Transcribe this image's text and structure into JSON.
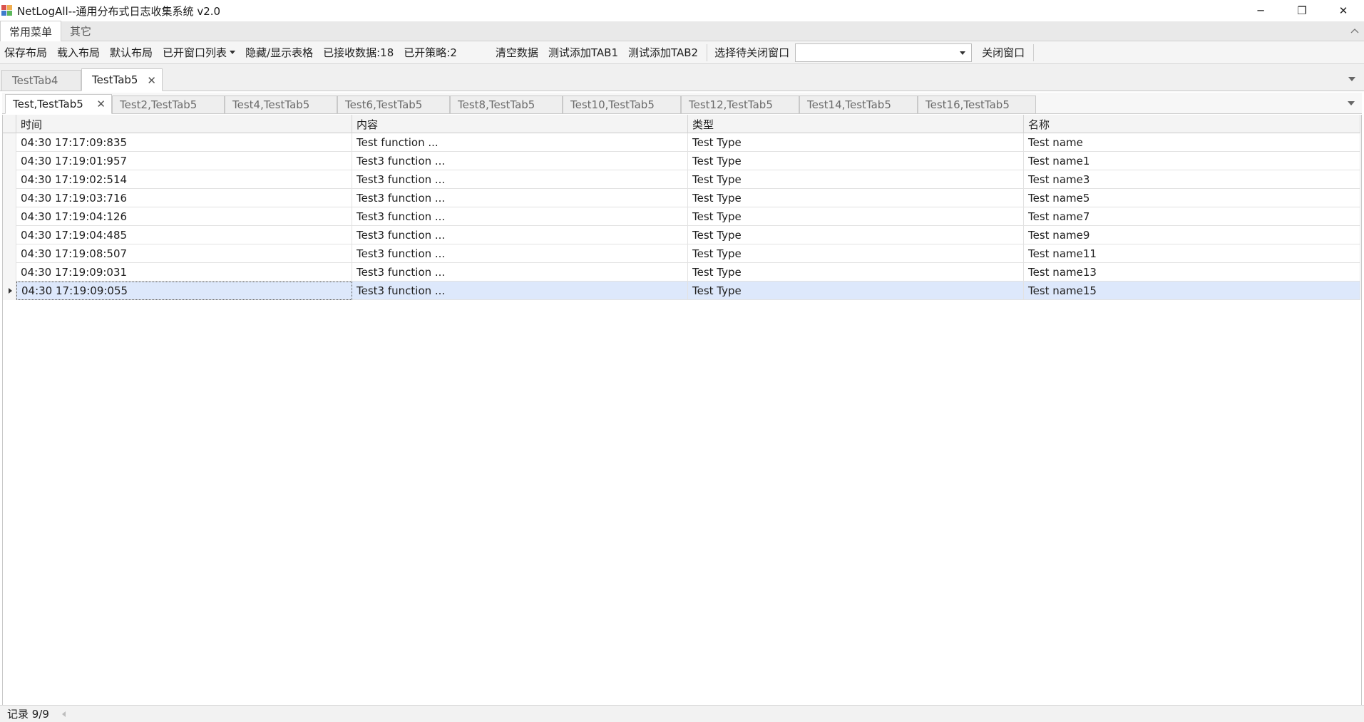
{
  "window": {
    "title": "NetLogAll--通用分布式日志收集系统 v2.0",
    "controls": {
      "minimize": "─",
      "restore": "❐",
      "close": "✕"
    }
  },
  "ribbon": {
    "tabs": [
      {
        "label": "常用菜单",
        "active": true
      },
      {
        "label": "其它",
        "active": false
      }
    ],
    "collapse_icon": "chevron-up-icon"
  },
  "toolbar": {
    "save_layout": "保存布局",
    "load_layout": "载入布局",
    "default_layout": "默认布局",
    "open_windows": "已开窗口列表",
    "toggle_grid": "隐藏/显示表格",
    "received": "已接收数据:18",
    "strategies": "已开策略:2",
    "clear_data": "清空数据",
    "test_add_tab1": "测试添加TAB1",
    "test_add_tab2": "测试添加TAB2",
    "select_close_label": "选择待关闭窗口",
    "select_close_value": "",
    "close_window": "关闭窗口"
  },
  "doc_tabs": [
    {
      "label": "TestTab4",
      "active": false
    },
    {
      "label": "TestTab5",
      "active": true
    }
  ],
  "inner_tabs": [
    {
      "label": "Test,TestTab5",
      "active": true
    },
    {
      "label": "Test2,TestTab5",
      "active": false
    },
    {
      "label": "Test4,TestTab5",
      "active": false
    },
    {
      "label": "Test6,TestTab5",
      "active": false
    },
    {
      "label": "Test8,TestTab5",
      "active": false
    },
    {
      "label": "Test10,TestTab5",
      "active": false
    },
    {
      "label": "Test12,TestTab5",
      "active": false
    },
    {
      "label": "Test14,TestTab5",
      "active": false
    },
    {
      "label": "Test16,TestTab5",
      "active": false
    }
  ],
  "grid": {
    "columns": [
      "时间",
      "内容",
      "类型",
      "名称"
    ],
    "rows": [
      [
        "04:30 17:17:09:835",
        "Test function ...",
        "Test Type",
        "Test name"
      ],
      [
        "04:30 17:19:01:957",
        "Test3 function ...",
        "Test Type",
        "Test name1"
      ],
      [
        "04:30 17:19:02:514",
        "Test3 function ...",
        "Test Type",
        "Test name3"
      ],
      [
        "04:30 17:19:03:716",
        "Test3 function ...",
        "Test Type",
        "Test name5"
      ],
      [
        "04:30 17:19:04:126",
        "Test3 function ...",
        "Test Type",
        "Test name7"
      ],
      [
        "04:30 17:19:04:485",
        "Test3 function ...",
        "Test Type",
        "Test name9"
      ],
      [
        "04:30 17:19:08:507",
        "Test3 function ...",
        "Test Type",
        "Test name11"
      ],
      [
        "04:30 17:19:09:031",
        "Test3 function ...",
        "Test Type",
        "Test name13"
      ],
      [
        "04:30 17:19:09:055",
        "Test3 function ...",
        "Test Type",
        "Test name15"
      ]
    ],
    "selected_row": 8
  },
  "status": {
    "records": "记录 9/9"
  },
  "colors": {
    "selected_row": "#dde8fb",
    "ribbon_bg": "#e9e9e9",
    "toolbar_bg": "#f5f5f5"
  }
}
